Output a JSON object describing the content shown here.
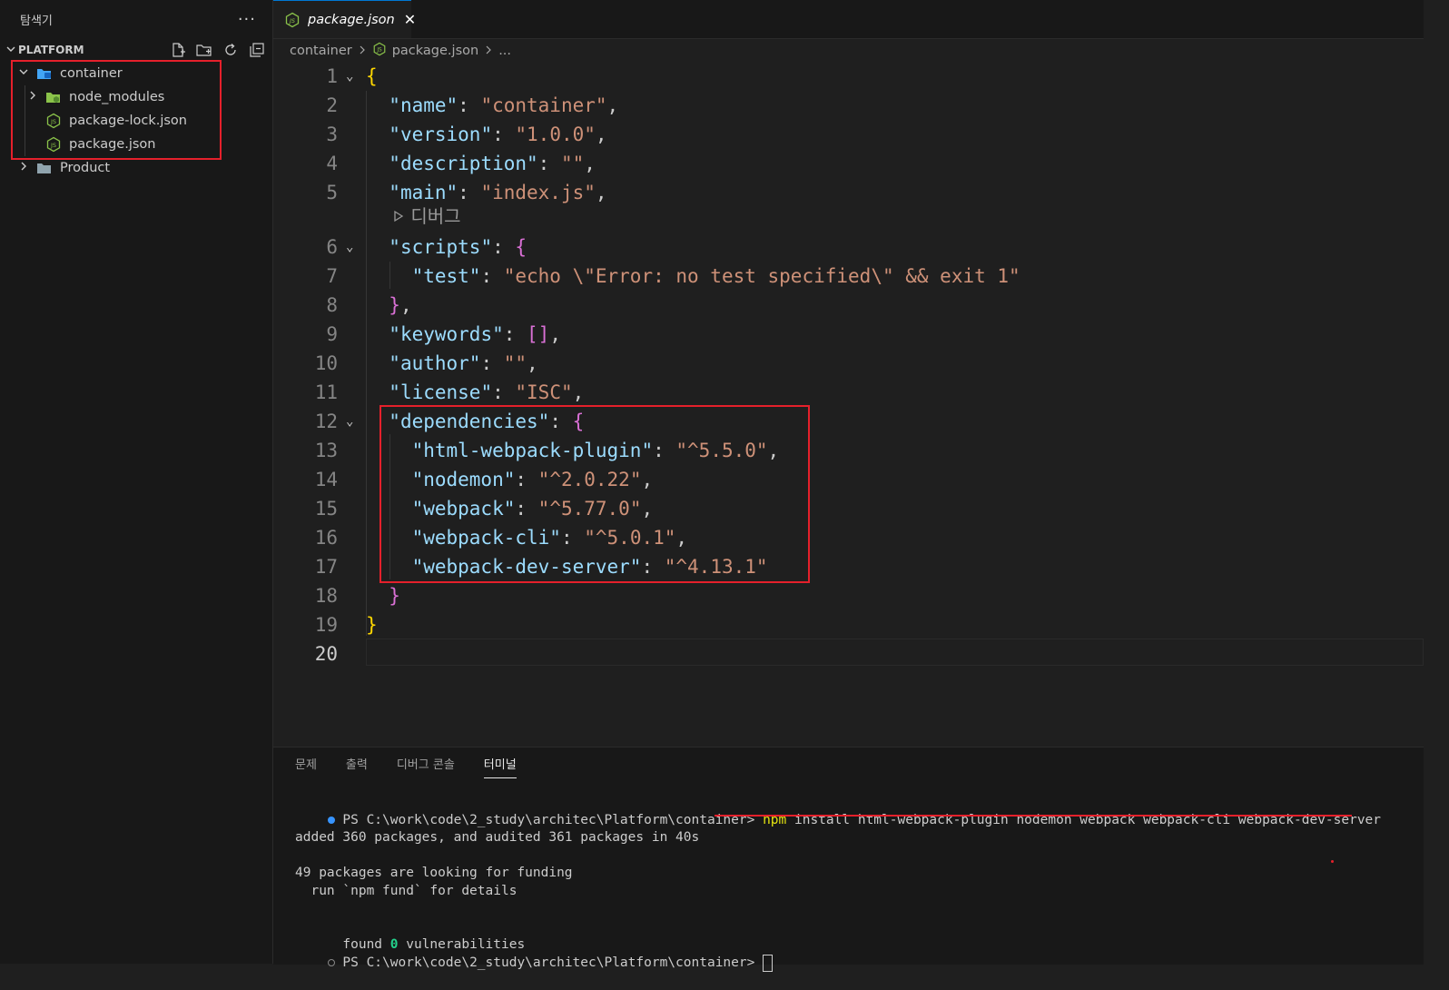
{
  "sidebar": {
    "title": "탐색기",
    "more": "···",
    "section": "PLATFORM",
    "tree": {
      "container": "container",
      "node_modules": "node_modules",
      "package_lock": "package-lock.json",
      "package_json": "package.json",
      "product": "Product"
    }
  },
  "editor": {
    "tab_label": "package.json",
    "breadcrumb": [
      "container",
      "package.json",
      "..."
    ],
    "codelens": "디버그",
    "lines": [
      {
        "n": "1"
      },
      {
        "n": "2"
      },
      {
        "n": "3"
      },
      {
        "n": "4"
      },
      {
        "n": "5"
      },
      {
        "n": "6"
      },
      {
        "n": "7"
      },
      {
        "n": "8"
      },
      {
        "n": "9"
      },
      {
        "n": "10"
      },
      {
        "n": "11"
      },
      {
        "n": "12"
      },
      {
        "n": "13"
      },
      {
        "n": "14"
      },
      {
        "n": "15"
      },
      {
        "n": "16"
      },
      {
        "n": "17"
      },
      {
        "n": "18"
      },
      {
        "n": "19"
      },
      {
        "n": "20"
      }
    ],
    "json": {
      "name_key": "\"name\"",
      "name_val": "\"container\"",
      "version_key": "\"version\"",
      "version_val": "\"1.0.0\"",
      "description_key": "\"description\"",
      "description_val": "\"\"",
      "main_key": "\"main\"",
      "main_val": "\"index.js\"",
      "scripts_key": "\"scripts\"",
      "test_key": "\"test\"",
      "test_val": "\"echo \\\"Error: no test specified\\\" && exit 1\"",
      "keywords_key": "\"keywords\"",
      "keywords_val": "[]",
      "author_key": "\"author\"",
      "author_val": "\"\"",
      "license_key": "\"license\"",
      "license_val": "\"ISC\"",
      "deps_key": "\"dependencies\"",
      "dep1_key": "\"html-webpack-plugin\"",
      "dep1_val": "\"^5.5.0\"",
      "dep2_key": "\"nodemon\"",
      "dep2_val": "\"^2.0.22\"",
      "dep3_key": "\"webpack\"",
      "dep3_val": "\"^5.77.0\"",
      "dep4_key": "\"webpack-cli\"",
      "dep4_val": "\"^5.0.1\"",
      "dep5_key": "\"webpack-dev-server\"",
      "dep5_val": "\"^4.13.1\""
    }
  },
  "panel": {
    "tabs": [
      "문제",
      "출력",
      "디버그 콘솔",
      "터미널"
    ],
    "terminal": {
      "prompt": "PS C:\\work\\code\\2_study\\architec\\Platform\\container> ",
      "cmd_npm": "npm",
      "cmd_rest": " install html-webpack-plugin nodemon webpack webpack-cli webpack-dev-server",
      "added": "added 360 packages, and audited 361 packages in 40s",
      "funding": "49 packages are looking for funding",
      "fund_hint": "  run `npm fund` for details",
      "found": "found ",
      "vuln_count": "0",
      "vuln_text": " vulnerabilities",
      "prompt2": "PS C:\\work\\code\\2_study\\architec\\Platform\\container> "
    }
  },
  "colors": {
    "accent": "#0078d4",
    "highlight_box": "#e5202b",
    "json_key": "#9cdcfe",
    "json_string": "#ce9178",
    "bracket_level1": "#ffd700",
    "bracket_level2": "#da70d6"
  }
}
